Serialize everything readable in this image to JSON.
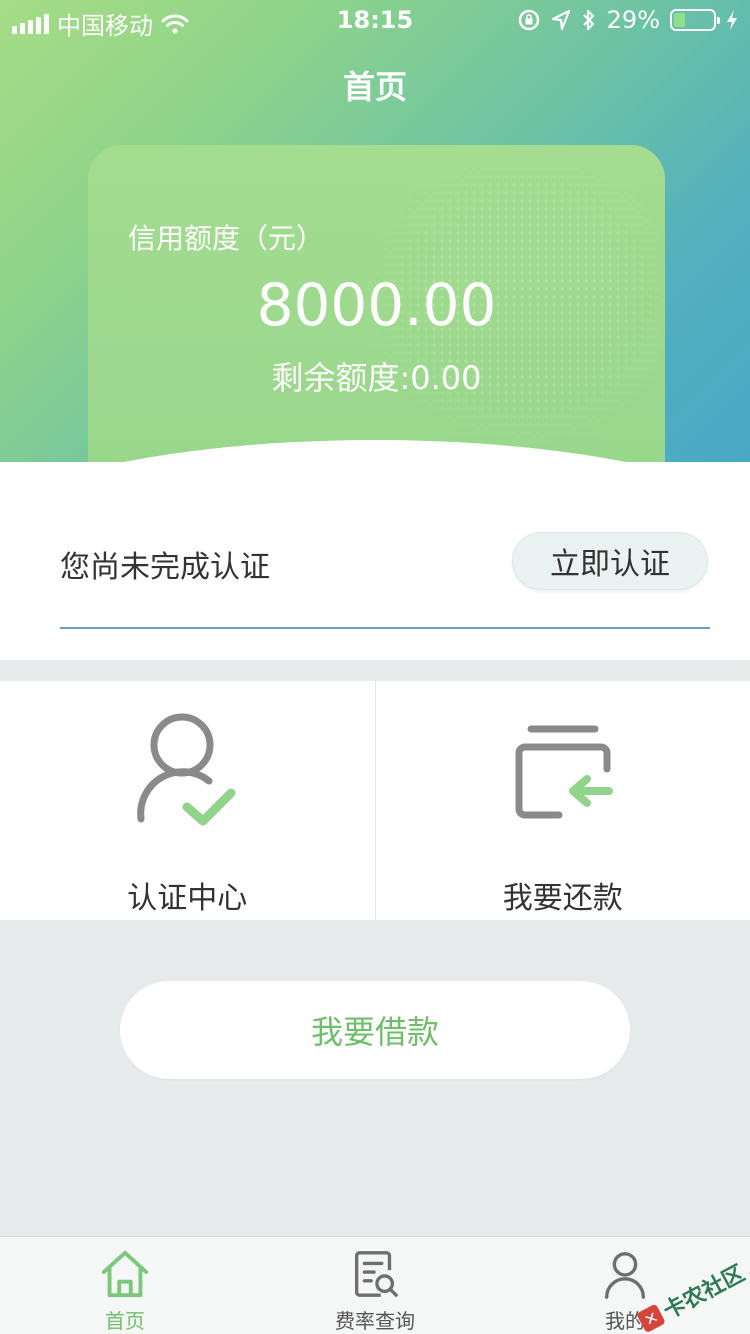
{
  "status_bar": {
    "carrier": "中国移动",
    "time": "18:15",
    "battery_percent": "29%",
    "battery_level": 0.29,
    "icons": [
      "signal-icon",
      "wifi-icon",
      "rotation-lock-icon",
      "location-icon",
      "bluetooth-icon",
      "battery-icon",
      "charging-icon"
    ]
  },
  "nav": {
    "title": "首页"
  },
  "card": {
    "label": "信用额度（元）",
    "amount": "8000.00",
    "remaining": "剩余额度:0.00"
  },
  "verify": {
    "message": "您尚未完成认证",
    "button_label": "立即认证"
  },
  "features": [
    {
      "label": "认证中心",
      "icon": "user-check-icon"
    },
    {
      "label": "我要还款",
      "icon": "repay-card-icon"
    }
  ],
  "borrow": {
    "label": "我要借款"
  },
  "tabbar": {
    "items": [
      {
        "label": "首页",
        "icon": "home-icon",
        "active": true
      },
      {
        "label": "费率查询",
        "icon": "rate-search-icon",
        "active": false
      },
      {
        "label": "我的",
        "icon": "profile-icon",
        "active": false
      }
    ]
  },
  "watermark": {
    "text": "卡农社区"
  },
  "colors": {
    "accent_green": "#6fbf6a",
    "card_green": "#9cd98e",
    "gradient_start": "#a6dc86",
    "gradient_end": "#4aa8c6",
    "underline_blue": "#6a9bc9"
  }
}
